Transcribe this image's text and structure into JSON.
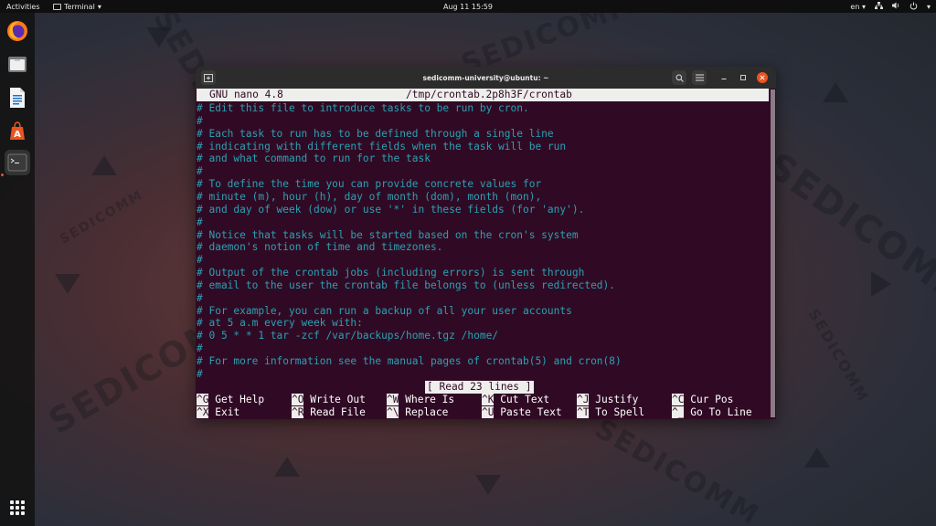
{
  "topbar": {
    "activities": "Activities",
    "app_menu": "Terminal",
    "clock": "Aug 11  15:59",
    "lang": "en"
  },
  "dock": {
    "items": [
      "firefox",
      "files",
      "writer",
      "software",
      "terminal"
    ],
    "apps_icon": "show-applications-icon"
  },
  "wallpaper": {
    "text": "SEDICOMM"
  },
  "window": {
    "title": "sedicomm-university@ubuntu: ~",
    "accent": "#e95420",
    "background": "#300a24"
  },
  "nano": {
    "version": "GNU nano 4.8",
    "filename": "/tmp/crontab.2p8h3F/crontab",
    "lines": [
      "# Edit this file to introduce tasks to be run by cron.",
      "#",
      "# Each task to run has to be defined through a single line",
      "# indicating with different fields when the task will be run",
      "# and what command to run for the task",
      "#",
      "# To define the time you can provide concrete values for",
      "# minute (m), hour (h), day of month (dom), month (mon),",
      "# and day of week (dow) or use '*' in these fields (for 'any').",
      "#",
      "# Notice that tasks will be started based on the cron's system",
      "# daemon's notion of time and timezones.",
      "#",
      "# Output of the crontab jobs (including errors) is sent through",
      "# email to the user the crontab file belongs to (unless redirected).",
      "#",
      "# For example, you can run a backup of all your user accounts",
      "# at 5 a.m every week with:",
      "# 0 5 * * 1 tar -zcf /var/backups/home.tgz /home/",
      "#",
      "# For more information see the manual pages of crontab(5) and cron(8)",
      "#"
    ],
    "status": "[ Read 23 lines ]",
    "shortcuts_row1": [
      {
        "key": "^G",
        "label": "Get Help"
      },
      {
        "key": "^O",
        "label": "Write Out"
      },
      {
        "key": "^W",
        "label": "Where Is"
      },
      {
        "key": "^K",
        "label": "Cut Text"
      },
      {
        "key": "^J",
        "label": "Justify"
      },
      {
        "key": "^C",
        "label": "Cur Pos"
      }
    ],
    "shortcuts_row2": [
      {
        "key": "^X",
        "label": "Exit"
      },
      {
        "key": "^R",
        "label": "Read File"
      },
      {
        "key": "^\\",
        "label": "Replace"
      },
      {
        "key": "^U",
        "label": "Paste Text"
      },
      {
        "key": "^T",
        "label": "To Spell"
      },
      {
        "key": "^_",
        "label": "Go To Line"
      }
    ]
  }
}
